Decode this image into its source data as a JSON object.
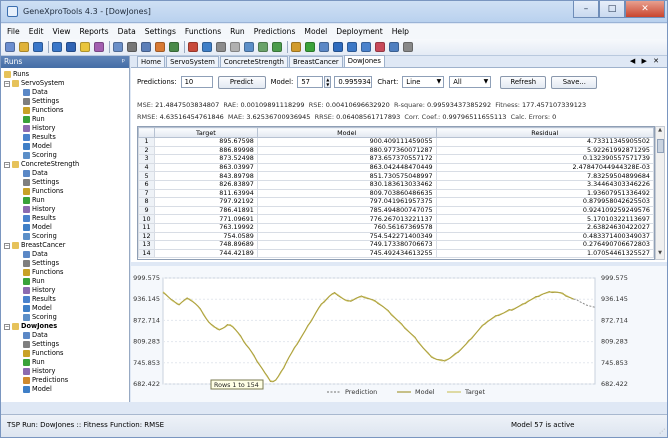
{
  "window": {
    "title": "GeneXproTools 4.3 - [DowJones]"
  },
  "menu": [
    "File",
    "Edit",
    "View",
    "Reports",
    "Data",
    "Settings",
    "Functions",
    "Run",
    "Predictions",
    "Model",
    "Deployment",
    "Help"
  ],
  "runs_panel": {
    "header": "Runs",
    "root": "Runs",
    "projects": [
      {
        "name": "ServoSystem",
        "items": [
          "Data",
          "Settings",
          "Functions",
          "Run",
          "History",
          "Results",
          "Model",
          "Scoring"
        ]
      },
      {
        "name": "ConcreteStrength",
        "items": [
          "Data",
          "Settings",
          "Functions",
          "Run",
          "History",
          "Results",
          "Model",
          "Scoring"
        ]
      },
      {
        "name": "BreastCancer",
        "items": [
          "Data",
          "Settings",
          "Functions",
          "Run",
          "History",
          "Results",
          "Model",
          "Scoring"
        ]
      },
      {
        "name": "DowJones",
        "items": [
          "Data",
          "Settings",
          "Functions",
          "Run",
          "History",
          "Predictions",
          "Model"
        ]
      }
    ]
  },
  "tabs": [
    "Home",
    "ServoSystem",
    "ConcreteStrength",
    "BreastCancer",
    "DowJones"
  ],
  "active_tab": "DowJones",
  "tab_nav": "◀ ▶ ✕",
  "controls": {
    "predictions_label": "Predictions:",
    "predictions_value": "10",
    "predict_button": "Predict",
    "model_label": "Model:",
    "model_value": "57",
    "model_fitness": "0.995934",
    "chart_label": "Chart:",
    "chart_type": "Line",
    "chart_filter": "All",
    "refresh_button": "Refresh",
    "save_button": "Save..."
  },
  "stats": {
    "mse_label": "MSE:",
    "mse": "21.4847503834807",
    "rae_label": "RAE:",
    "rae": "0.00109891118299",
    "rse_label": "RSE:",
    "rse": "0.00410696632920",
    "rsq_label": "R-square:",
    "rsq": "0.99593437385292",
    "fitness_label": "Fitness:",
    "fitness": "177.457107339123",
    "rmse_label": "RMSE:",
    "rmse": "4.63516454761846",
    "mae_label": "MAE:",
    "mae": "3.62536700936945",
    "rrse_label": "RRSE:",
    "rrse": "0.06408561717893",
    "corr_label": "Corr. Coef.:",
    "corr": "0.99796511655113",
    "calc_label": "Calc. Errors:",
    "calc": "0"
  },
  "table": {
    "columns": [
      "Target",
      "Model",
      "Residual"
    ],
    "rows": [
      [
        "1",
        "895.67598",
        "900.409111459055",
        "4.73311345905502"
      ],
      [
        "2",
        "886.89998",
        "880.977360071287",
        "5.92261992871295"
      ],
      [
        "3",
        "873.52498",
        "873.657370557172",
        "0.132390557571739"
      ],
      [
        "4",
        "863.03997",
        "863.042448470449",
        "2.47847044944328E-03"
      ],
      [
        "5",
        "843.89798",
        "851.730575048997",
        "7.83259504899684"
      ],
      [
        "6",
        "826.83897",
        "830.183613033462",
        "3.34464303346226"
      ],
      [
        "7",
        "811.63994",
        "809.703860486635",
        "1.93607951336492"
      ],
      [
        "8",
        "797.92192",
        "797.041961957375",
        "0.879958042625503"
      ],
      [
        "9",
        "786.41891",
        "785.494800747075",
        "0.924109259249576"
      ],
      [
        "10",
        "771.09691",
        "776.267013221137",
        "5.17010322113697"
      ],
      [
        "11",
        "763.19992",
        "760.56167369578",
        "2.63824630422027"
      ],
      [
        "12",
        "754.0589",
        "754.542271400349",
        "0.483371400349037"
      ],
      [
        "13",
        "748.89689",
        "749.173380706673",
        "0.276490706672803"
      ],
      [
        "14",
        "744.42189",
        "745.492434613255",
        "1.07054461325527"
      ]
    ]
  },
  "chart_data": {
    "type": "line",
    "yticks": [
      "999.575",
      "936.145",
      "872.714",
      "809.283",
      "745.853",
      "682.422"
    ],
    "ylim": [
      682.422,
      999.575
    ],
    "legend": [
      "Prediction",
      "Model",
      "Target"
    ],
    "series_colors": {
      "Prediction": "#8a8a8a",
      "Model": "#a79a3c",
      "Target": "#cfc76a"
    },
    "annotation": "Rows 1 to 154",
    "target": [
      958,
      951,
      943,
      935,
      929,
      925,
      920,
      927,
      933,
      938,
      936,
      930,
      923,
      915,
      905,
      893,
      880,
      868,
      860,
      853,
      850,
      845,
      848,
      852,
      858,
      860,
      854,
      845,
      835,
      824,
      812,
      800,
      790,
      778,
      765,
      752,
      740,
      728,
      715,
      703,
      692,
      690,
      694,
      705,
      718,
      732,
      748,
      763,
      776,
      790,
      803,
      816,
      829,
      842,
      856,
      869,
      882,
      896,
      909,
      920,
      929,
      937,
      945,
      951,
      954,
      950,
      944,
      938,
      933,
      930,
      932,
      935,
      939,
      942,
      944,
      943,
      940,
      937,
      934,
      930,
      926,
      920,
      914,
      907,
      900,
      892,
      884,
      876,
      868,
      860,
      852,
      844,
      836,
      828,
      820,
      810,
      800,
      790,
      781,
      772,
      765,
      760,
      756,
      754,
      752,
      753,
      756,
      760,
      766,
      772,
      779,
      786,
      794,
      802,
      811,
      820,
      829,
      838,
      847,
      856,
      864,
      870,
      875,
      880,
      885,
      889,
      892,
      895,
      899,
      903,
      905,
      908,
      912,
      916,
      920,
      925,
      930,
      934,
      938,
      942,
      946,
      950,
      953,
      955,
      957,
      958,
      958,
      957,
      955,
      952,
      948,
      944,
      940,
      936
    ],
    "prediction": [
      936,
      930,
      926,
      922,
      918,
      916,
      914,
      912
    ]
  },
  "statusbar": {
    "left": "TSP Run: DowJones :: Fitness Function: RMSE",
    "right": "Model 57 is active"
  }
}
